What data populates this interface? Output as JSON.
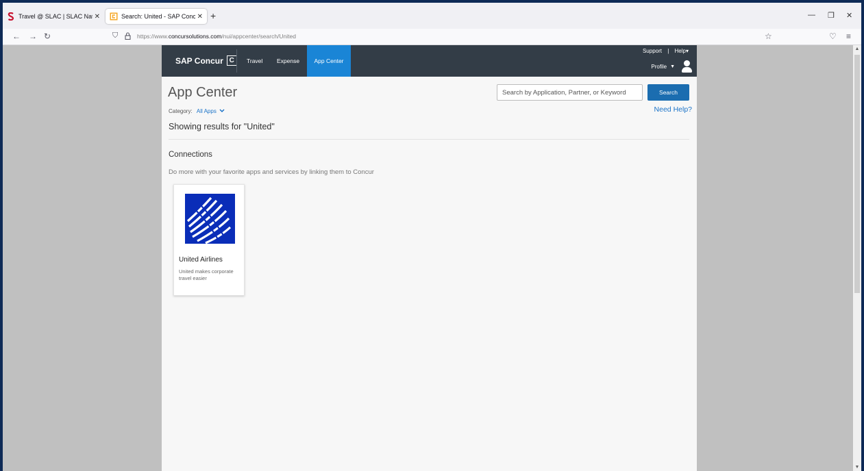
{
  "browser": {
    "tabs": [
      {
        "title": "Travel @ SLAC | SLAC National A",
        "favicon": "slac-s-icon",
        "active": false
      },
      {
        "title": "Search: United - SAP Concur Ap",
        "favicon": "concur-c-icon",
        "active": true
      }
    ],
    "new_tab": "+",
    "url_prefix": "https://www.",
    "url_domain": "concursolutions.com",
    "url_path": "/nui/appcenter/search/United"
  },
  "header": {
    "logo_text": "SAP Concur",
    "logo_mark": "C",
    "nav": [
      "Travel",
      "Expense",
      "App Center"
    ],
    "active_nav": "App Center",
    "support": "Support",
    "separator": "|",
    "help": "Help",
    "profile": "Profile"
  },
  "main": {
    "title": "App Center",
    "search_placeholder": "Search by Application, Partner, or Keyword",
    "search_button": "Search",
    "category_label": "Category:",
    "category_value": "All Apps",
    "need_help": "Need Help?",
    "results_text": "Showing results for \"United\"",
    "section_title": "Connections",
    "section_desc": "Do more with your favorite apps and services by linking them to Concur",
    "cards": [
      {
        "name": "United Airlines",
        "description": "United makes corporate travel easier",
        "logo": "united-globe-logo"
      }
    ]
  },
  "colors": {
    "header_bg": "#333d47",
    "active_nav": "#1a85d6",
    "search_button": "#1b6db0",
    "link": "#1a73c8",
    "united_blue": "#0a2db8"
  }
}
